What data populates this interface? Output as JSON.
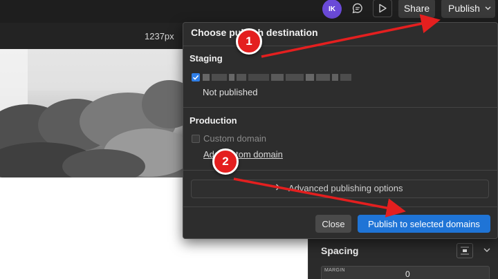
{
  "topbar": {
    "avatar_initials": "IK",
    "share_label": "Share",
    "publish_label": "Publish"
  },
  "canvas": {
    "width_label": "1237px"
  },
  "publish_popover": {
    "title": "Choose publish destination",
    "staging": {
      "heading": "Staging",
      "checked": true,
      "status": "Not published"
    },
    "production": {
      "heading": "Production",
      "custom_domain_label": "Custom domain",
      "checked": false,
      "add_custom_domain_link": "Add custom domain"
    },
    "advanced_options_label": "Advanced publishing options",
    "close_label": "Close",
    "publish_selected_label": "Publish to selected domains"
  },
  "right_panel": {
    "spacing_title": "Spacing",
    "margin_label": "MARGIN",
    "margin_value": "0"
  },
  "annotations": {
    "step_1": "1",
    "step_2": "2"
  },
  "colors": {
    "accent": "#1f74d6",
    "checkbox": "#2f7fe8",
    "annotation_red": "#e41f1f",
    "avatar": "#6a4ad8"
  },
  "icons": [
    "comment-icon",
    "play-icon",
    "chevron-down-icon",
    "check-icon",
    "chevron-right-icon",
    "spacing-icon"
  ]
}
